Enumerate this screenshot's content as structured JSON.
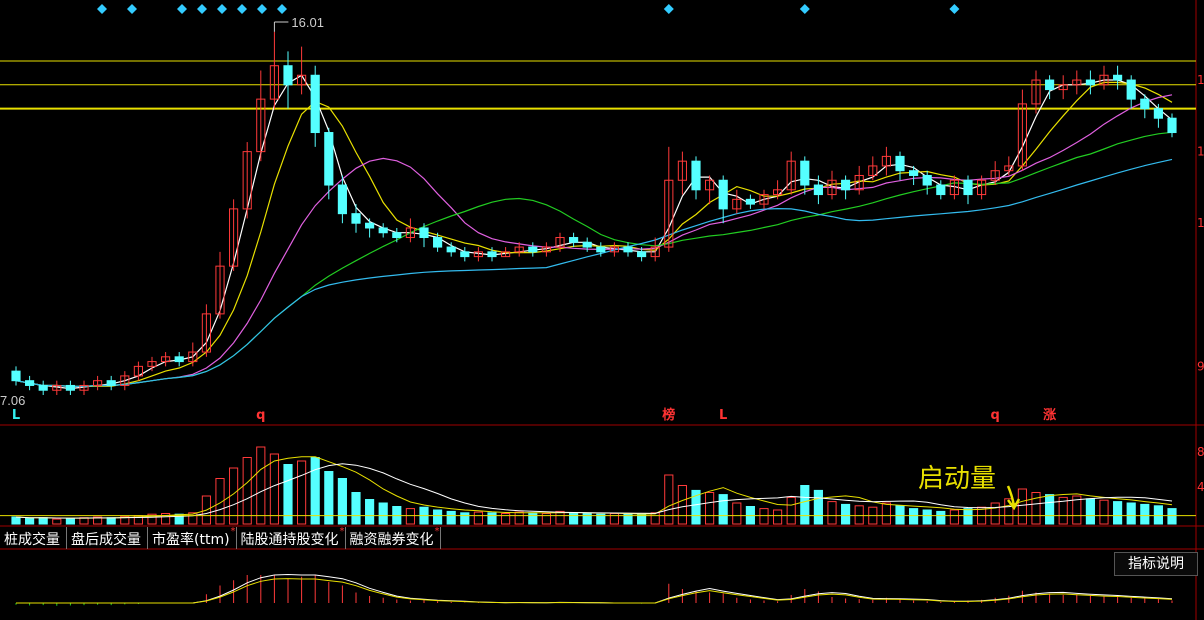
{
  "chart_data": {
    "type": "candlestick",
    "price": {
      "high_label": "16.01",
      "low_label": "7.06",
      "right_ticks": [
        "1",
        "1",
        "1",
        "9"
      ],
      "markers": [
        {
          "bar": 0,
          "text": "L",
          "color": "#3ee"
        },
        {
          "bar": 18,
          "text": "q",
          "color": "#f33"
        },
        {
          "bar": 48,
          "text": "榜",
          "color": "#f33"
        },
        {
          "bar": 52,
          "text": "L",
          "color": "#f33"
        },
        {
          "bar": 72,
          "text": "q",
          "color": "#f33"
        },
        {
          "bar": 76,
          "text": "涨",
          "color": "#f33"
        }
      ],
      "diamond_bars": [
        4,
        7,
        12,
        14,
        16,
        18,
        20,
        22,
        48,
        58,
        69
      ],
      "candles": [
        [
          8.9,
          8.7,
          9.0,
          8.6
        ],
        [
          8.7,
          8.6,
          8.8,
          8.5
        ],
        [
          8.6,
          8.5,
          8.7,
          8.4
        ],
        [
          8.5,
          8.6,
          8.7,
          8.4
        ],
        [
          8.6,
          8.5,
          8.7,
          8.4
        ],
        [
          8.5,
          8.6,
          8.7,
          8.4
        ],
        [
          8.6,
          8.7,
          8.8,
          8.5
        ],
        [
          8.7,
          8.6,
          8.8,
          8.5
        ],
        [
          8.6,
          8.8,
          8.9,
          8.5
        ],
        [
          8.8,
          9.0,
          9.1,
          8.7
        ],
        [
          9.0,
          9.1,
          9.2,
          8.9
        ],
        [
          9.1,
          9.2,
          9.3,
          9.0
        ],
        [
          9.2,
          9.1,
          9.3,
          9.0
        ],
        [
          9.1,
          9.3,
          9.5,
          9.0
        ],
        [
          9.3,
          10.1,
          10.3,
          9.2
        ],
        [
          10.1,
          11.1,
          11.4,
          10.0
        ],
        [
          11.1,
          12.3,
          12.5,
          11.0
        ],
        [
          12.3,
          13.5,
          13.7,
          12.1
        ],
        [
          13.5,
          14.6,
          15.2,
          13.3
        ],
        [
          14.6,
          15.3,
          16.01,
          14.4
        ],
        [
          15.3,
          14.9,
          15.6,
          14.4
        ],
        [
          14.9,
          15.1,
          15.7,
          14.7
        ],
        [
          15.1,
          13.9,
          15.3,
          13.6
        ],
        [
          13.9,
          12.8,
          14.0,
          12.5
        ],
        [
          12.8,
          12.2,
          13.0,
          12.0
        ],
        [
          12.2,
          12.0,
          12.4,
          11.8
        ],
        [
          12.0,
          11.9,
          12.1,
          11.7
        ],
        [
          11.9,
          11.8,
          12.0,
          11.7
        ],
        [
          11.8,
          11.7,
          11.9,
          11.6
        ],
        [
          11.7,
          11.9,
          12.1,
          11.6
        ],
        [
          11.9,
          11.7,
          12.0,
          11.5
        ],
        [
          11.7,
          11.5,
          11.8,
          11.4
        ],
        [
          11.5,
          11.4,
          11.6,
          11.3
        ],
        [
          11.4,
          11.3,
          11.5,
          11.2
        ],
        [
          11.3,
          11.4,
          11.5,
          11.2
        ],
        [
          11.4,
          11.3,
          11.5,
          11.2
        ],
        [
          11.3,
          11.4,
          11.5,
          11.3
        ],
        [
          11.4,
          11.5,
          11.6,
          11.3
        ],
        [
          11.5,
          11.4,
          11.6,
          11.3
        ],
        [
          11.4,
          11.5,
          11.6,
          11.3
        ],
        [
          11.5,
          11.7,
          11.8,
          11.4
        ],
        [
          11.7,
          11.6,
          11.8,
          11.5
        ],
        [
          11.6,
          11.5,
          11.7,
          11.4
        ],
        [
          11.5,
          11.4,
          11.6,
          11.3
        ],
        [
          11.4,
          11.5,
          11.6,
          11.3
        ],
        [
          11.5,
          11.4,
          11.6,
          11.3
        ],
        [
          11.4,
          11.3,
          11.5,
          11.2
        ],
        [
          11.3,
          11.5,
          11.7,
          11.2
        ],
        [
          11.5,
          12.9,
          13.6,
          11.4
        ],
        [
          12.9,
          13.3,
          13.5,
          12.6
        ],
        [
          13.3,
          12.7,
          13.4,
          12.5
        ],
        [
          12.7,
          12.9,
          13.0,
          12.4
        ],
        [
          12.9,
          12.3,
          13.0,
          12.0
        ],
        [
          12.3,
          12.5,
          12.7,
          12.2
        ],
        [
          12.5,
          12.4,
          12.6,
          12.3
        ],
        [
          12.4,
          12.6,
          12.7,
          12.3
        ],
        [
          12.6,
          12.7,
          12.9,
          12.5
        ],
        [
          12.7,
          13.3,
          13.5,
          12.6
        ],
        [
          13.3,
          12.8,
          13.4,
          12.6
        ],
        [
          12.8,
          12.6,
          13.0,
          12.4
        ],
        [
          12.6,
          12.9,
          13.1,
          12.5
        ],
        [
          12.9,
          12.7,
          13.0,
          12.5
        ],
        [
          12.7,
          13.0,
          13.2,
          12.6
        ],
        [
          13.0,
          13.2,
          13.4,
          12.9
        ],
        [
          13.2,
          13.4,
          13.6,
          13.0
        ],
        [
          13.4,
          13.1,
          13.5,
          12.9
        ],
        [
          13.1,
          13.0,
          13.2,
          12.8
        ],
        [
          13.0,
          12.8,
          13.1,
          12.6
        ],
        [
          12.8,
          12.6,
          12.9,
          12.5
        ],
        [
          12.6,
          12.9,
          13.0,
          12.5
        ],
        [
          12.9,
          12.6,
          13.0,
          12.4
        ],
        [
          12.6,
          12.9,
          13.0,
          12.5
        ],
        [
          12.9,
          13.1,
          13.3,
          12.8
        ],
        [
          13.1,
          13.2,
          13.4,
          13.0
        ],
        [
          13.2,
          14.5,
          14.8,
          13.1
        ],
        [
          14.5,
          15.0,
          15.2,
          14.3
        ],
        [
          15.0,
          14.8,
          15.1,
          14.6
        ],
        [
          14.8,
          14.9,
          15.1,
          14.6
        ],
        [
          14.9,
          15.0,
          15.2,
          14.7
        ],
        [
          15.0,
          14.9,
          15.2,
          14.7
        ],
        [
          14.9,
          15.1,
          15.3,
          14.8
        ],
        [
          15.1,
          15.0,
          15.3,
          14.8
        ],
        [
          15.0,
          14.6,
          15.1,
          14.4
        ],
        [
          14.6,
          14.4,
          14.7,
          14.2
        ],
        [
          14.4,
          14.2,
          14.5,
          14.0
        ],
        [
          14.2,
          13.9,
          14.3,
          13.8
        ]
      ],
      "h_levels": [
        15.4,
        14.9,
        14.4
      ]
    },
    "volume": {
      "values": [
        10,
        8,
        9,
        7,
        8,
        9,
        10,
        9,
        11,
        12,
        14,
        15,
        14,
        16,
        40,
        65,
        80,
        95,
        110,
        100,
        85,
        90,
        95,
        75,
        65,
        45,
        35,
        30,
        25,
        22,
        24,
        20,
        18,
        16,
        17,
        16,
        15,
        17,
        16,
        15,
        18,
        16,
        15,
        14,
        15,
        14,
        13,
        16,
        70,
        55,
        48,
        45,
        42,
        30,
        25,
        22,
        20,
        38,
        55,
        48,
        32,
        28,
        26,
        24,
        30,
        26,
        22,
        20,
        18,
        20,
        22,
        24,
        30,
        36,
        50,
        45,
        42,
        38,
        40,
        36,
        34,
        32,
        30,
        28,
        26,
        22
      ],
      "note": "启动量"
    },
    "tabs": [
      {
        "label": "桩成交量",
        "star": false
      },
      {
        "label": "盘后成交量",
        "star": false
      },
      {
        "label": "市盈率(ttm)",
        "star": true
      },
      {
        "label": "陆股通持股变化",
        "star": true
      },
      {
        "label": "融资融券变化",
        "star": true
      }
    ],
    "help_button": "指标说明",
    "colors": {
      "up": "#ff3a3a",
      "down": "#5ff",
      "ma1": "#fff",
      "ma2": "#e8e000",
      "ma3": "#e060e0",
      "ma4": "#22cc22",
      "ma5": "#33bbee",
      "level": "#e8e000",
      "frame": "#a00000"
    }
  }
}
